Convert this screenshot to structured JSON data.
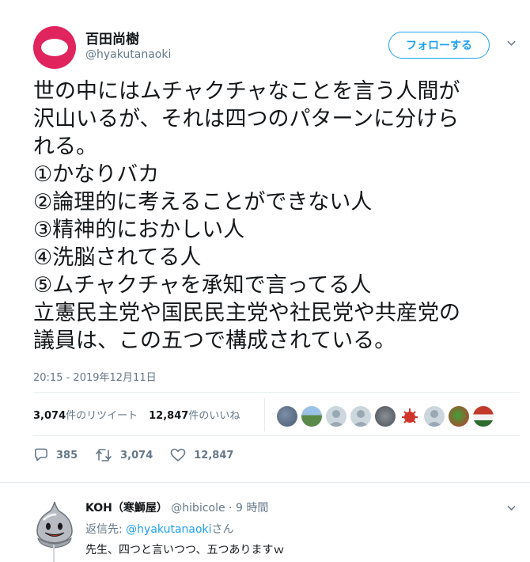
{
  "tweet": {
    "author_name": "百田尚樹",
    "author_handle": "@hyakutanaoki",
    "follow_label": "フォローする",
    "lines": [
      "世の中にはムチャクチャなことを言う人間が",
      "沢山いるが、それは四つのパターンに分けら",
      "れる。",
      "①かなりバカ",
      "②論理的に考えることができない人",
      "③精神的におかしい人",
      "④洗脳されてる人",
      "⑤ムチャクチャを承知で言ってる人",
      "立憲民主党や国民民主党や社民党や共産党の",
      "議員は、この五つで構成されている。"
    ],
    "timestamp": "20:15 - 2019年12月11日",
    "retweets_count": "3,074",
    "retweets_label": "件のリツイート",
    "likes_count": "12,847",
    "likes_label": "件のいいね",
    "liker_avatars": 9
  },
  "actions": {
    "reply_count": "385",
    "retweet_count": "3,074",
    "like_count": "12,847"
  },
  "reply": {
    "name": "KOH（寒鰤屋）",
    "handle": "@hibicole",
    "separator": " · ",
    "time": "9 時間",
    "reply_prefix": "返信先: ",
    "reply_mention": "@hyakutanaoki",
    "reply_suffix": "さん",
    "text": "先生、四つと言いつつ、五つありますｗ"
  },
  "colors": {
    "accent": "#1da1f2",
    "avatar_red": "#e0245e",
    "secondary_text": "#657786",
    "divider": "#e6ecf0"
  },
  "icons": [
    "chevron-down-icon",
    "reply-icon",
    "retweet-icon",
    "heart-icon"
  ]
}
